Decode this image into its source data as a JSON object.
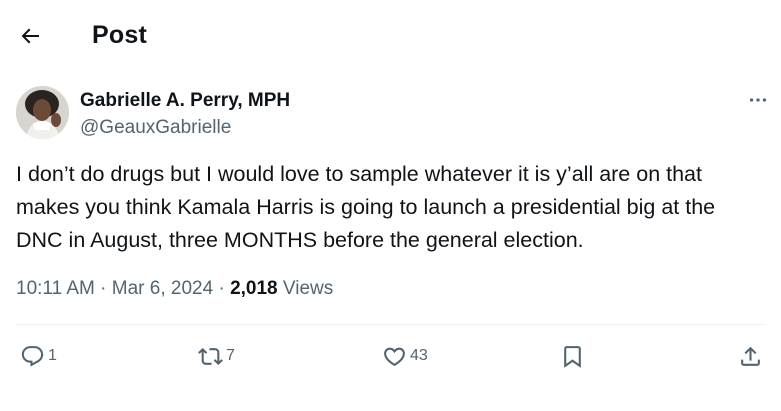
{
  "header": {
    "title": "Post",
    "back_icon": "arrow-left-icon"
  },
  "author": {
    "display_name": "Gabrielle A. Perry, MPH",
    "handle": "@GeauxGabrielle",
    "avatar_icon": "profile-photo"
  },
  "tweet": {
    "text": "I don’t do drugs but I would love to sample whatever it is y’all are on that\nmakes you think Kamala Harris is going to launch a presidential big at the\nDNC in August, three MONTHS before the general election.",
    "time": "10:11 AM",
    "date": "Mar 6, 2024",
    "separator": "·",
    "views_count": "2,018",
    "views_label": "Views"
  },
  "actions": {
    "reply_count": "1",
    "repost_count": "7",
    "like_count": "43",
    "reply_icon": "reply-icon",
    "repost_icon": "repost-icon",
    "like_icon": "heart-icon",
    "bookmark_icon": "bookmark-icon",
    "share_icon": "share-icon"
  },
  "colors": {
    "text_primary": "#0f1419",
    "text_secondary": "#536471",
    "divider": "#eff3f4",
    "background": "#ffffff"
  }
}
